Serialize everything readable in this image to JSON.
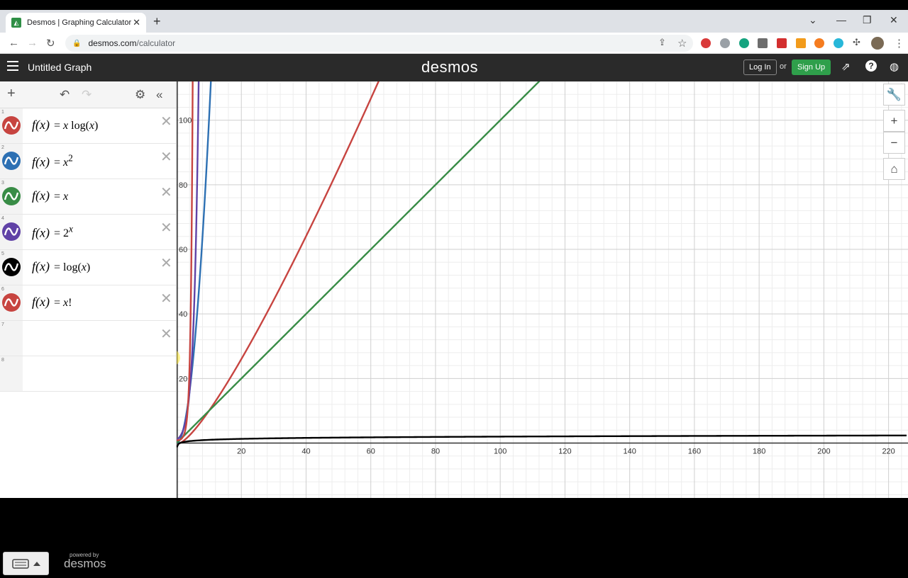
{
  "browser": {
    "tab_title": "Desmos | Graphing Calculator",
    "url_host": "desmos.com",
    "url_path": "/calculator"
  },
  "header": {
    "graph_title": "Untitled Graph",
    "logo": "desmos",
    "login_label": "Log In",
    "or_text": "or",
    "signup_label": "Sign Up"
  },
  "expressions": [
    {
      "num": "1",
      "color": "#c74440",
      "lhs": "f(x)",
      "rhs_html": "= <i>x</i> log(<i>x</i>)"
    },
    {
      "num": "2",
      "color": "#2d70b3",
      "lhs": "f(x)",
      "rhs_html": "= <i>x</i><sup>2</sup>"
    },
    {
      "num": "3",
      "color": "#388c46",
      "lhs": "f(x)",
      "rhs_html": "= <i>x</i>"
    },
    {
      "num": "4",
      "color": "#6042a6",
      "lhs": "f(x)",
      "rhs_html": "= 2<sup><i>x</i></sup>"
    },
    {
      "num": "5",
      "color": "#000000",
      "lhs": "f(x)",
      "rhs_html": "= log(<i>x</i>)"
    },
    {
      "num": "6",
      "color": "#c74440",
      "lhs": "f(x)",
      "rhs_html": "= <i>x</i>!"
    },
    {
      "num": "7",
      "color": "",
      "lhs": "",
      "rhs_html": ""
    },
    {
      "num": "8",
      "color": "",
      "lhs": "",
      "rhs_html": ""
    }
  ],
  "footer": {
    "powered_by": "powered by",
    "powered_logo": "desmos"
  },
  "chart_data": {
    "type": "line",
    "xlim": [
      0,
      226
    ],
    "ylim": [
      -17,
      112
    ],
    "x_ticks": [
      20,
      40,
      60,
      80,
      100,
      120,
      140,
      160,
      180,
      200,
      220
    ],
    "y_ticks": [
      20,
      40,
      60,
      80,
      100
    ],
    "grid": true,
    "series": [
      {
        "name": "x log(x)",
        "color": "#c74440",
        "expr": "xlogx"
      },
      {
        "name": "x^2",
        "color": "#2d70b3",
        "expr": "x2"
      },
      {
        "name": "x",
        "color": "#388c46",
        "expr": "x"
      },
      {
        "name": "2^x",
        "color": "#6042a6",
        "expr": "2x"
      },
      {
        "name": "log(x)",
        "color": "#000000",
        "expr": "logx"
      },
      {
        "name": "x!",
        "color": "#c74440",
        "expr": "fact"
      }
    ]
  }
}
